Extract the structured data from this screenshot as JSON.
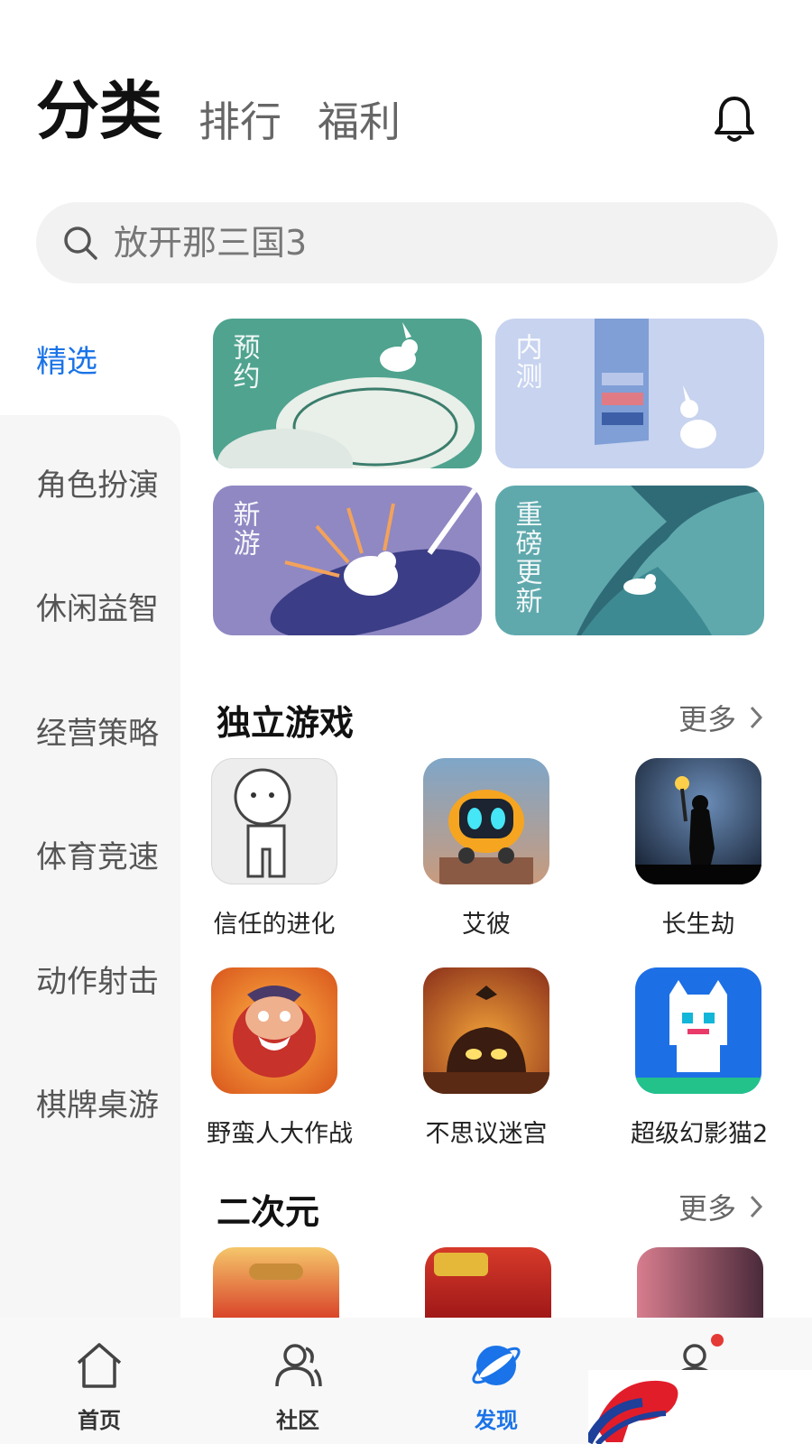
{
  "header": {
    "tabs": [
      {
        "label": "分类",
        "active": true
      },
      {
        "label": "排行",
        "active": false
      },
      {
        "label": "福利",
        "active": false
      }
    ],
    "bell_icon": "bell-icon"
  },
  "search": {
    "placeholder": "放开那三国3",
    "icon": "search-icon"
  },
  "sidebar": {
    "items": [
      {
        "label": "精选",
        "active": true
      },
      {
        "label": "角色扮演"
      },
      {
        "label": "休闲益智"
      },
      {
        "label": "经营策略"
      },
      {
        "label": "体育竞速"
      },
      {
        "label": "动作射击"
      },
      {
        "label": "棋牌桌游"
      }
    ]
  },
  "banners": [
    {
      "label": "预约",
      "color": "#4fa38f"
    },
    {
      "label": "内测",
      "color": "#c7d3ef"
    },
    {
      "label": "新游",
      "color": "#8f88c3"
    },
    {
      "label": "重磅更新",
      "color": "#5fa9ad"
    }
  ],
  "sections": [
    {
      "title": "独立游戏",
      "more": "更多",
      "apps": [
        {
          "name": "信任的进化"
        },
        {
          "name": "艾彼"
        },
        {
          "name": "长生劫"
        },
        {
          "name": "野蛮人大作战"
        },
        {
          "name": "不思议迷宫"
        },
        {
          "name": "超级幻影猫2"
        }
      ]
    },
    {
      "title": "二次元",
      "more": "更多"
    }
  ],
  "bottom_nav": {
    "items": [
      {
        "label": "首页",
        "icon": "home-icon"
      },
      {
        "label": "社区",
        "icon": "community-icon"
      },
      {
        "label": "发现",
        "icon": "discover-planet-icon",
        "active": true
      },
      {
        "label": "",
        "icon": "profile-icon",
        "badge": true
      }
    ]
  },
  "colors": {
    "accent": "#1a73e8",
    "badge": "#e53935"
  }
}
